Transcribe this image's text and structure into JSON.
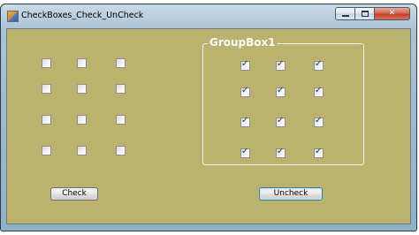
{
  "window": {
    "title": "CheckBoxes_Check_UnCheck",
    "close_glyph": "✕"
  },
  "groupbox": {
    "label": "GroupBox1"
  },
  "buttons": {
    "check_label": "Check",
    "uncheck_label": "Uncheck"
  },
  "checkboxes": {
    "outside": {
      "rows": 4,
      "cols": 3,
      "checked": false
    },
    "group": {
      "rows": 4,
      "cols": 3,
      "checked": true
    }
  },
  "colors": {
    "client_background": "#bbb36d",
    "group_border": "#f5f5ee",
    "group_label": "#ffffff"
  }
}
